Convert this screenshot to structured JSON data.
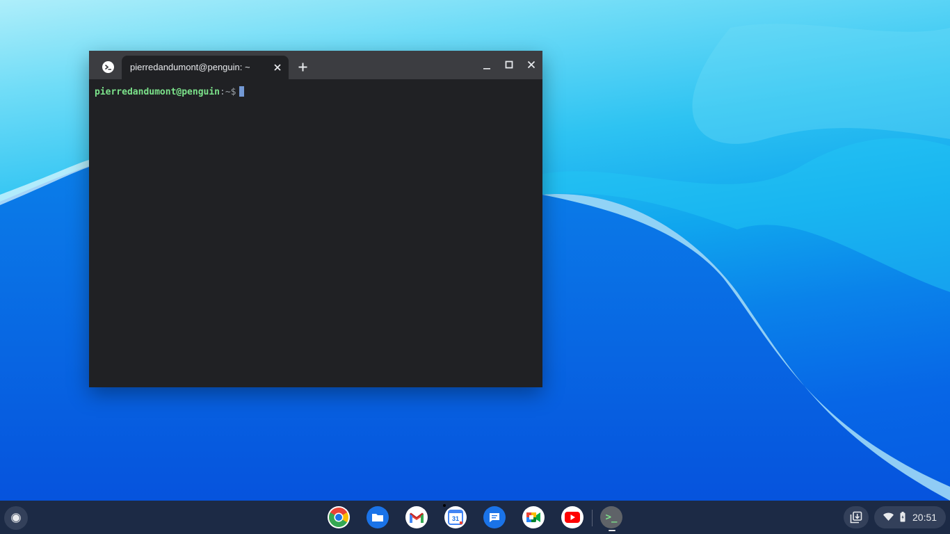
{
  "desktop": {
    "wallpaper": "blue-wave"
  },
  "terminal": {
    "tab_title": "pierredandumont@penguin: ~",
    "prompt_user": "pierredandumont@penguin",
    "prompt_path": ":~$",
    "icons": {
      "app": "terminal-icon",
      "close_tab": "close-icon",
      "new_tab": "plus-icon",
      "minimize": "minimize-icon",
      "maximize": "maximize-icon",
      "close": "close-icon"
    }
  },
  "shelf": {
    "launcher": "launcher-icon",
    "apps": [
      {
        "name": "Chrome",
        "icon": "chrome-icon"
      },
      {
        "name": "Files",
        "icon": "files-icon"
      },
      {
        "name": "Gmail",
        "icon": "gmail-icon"
      },
      {
        "name": "Calendar",
        "icon": "calendar-icon",
        "label": "31"
      },
      {
        "name": "Messages",
        "icon": "messages-icon"
      },
      {
        "name": "Meet",
        "icon": "meet-icon"
      },
      {
        "name": "YouTube",
        "icon": "youtube-icon"
      },
      {
        "name": "Terminal",
        "icon": "terminal-icon",
        "label": ">_"
      }
    ],
    "status": {
      "time": "20:51",
      "icons": [
        "wifi-icon",
        "battery-icon"
      ]
    },
    "holding_space": "holding-space-icon"
  },
  "colors": {
    "shelf": "#1c2a45",
    "terminal_bg": "#202124",
    "prompt_user": "#7ce38b",
    "cursor": "#7399d4"
  }
}
